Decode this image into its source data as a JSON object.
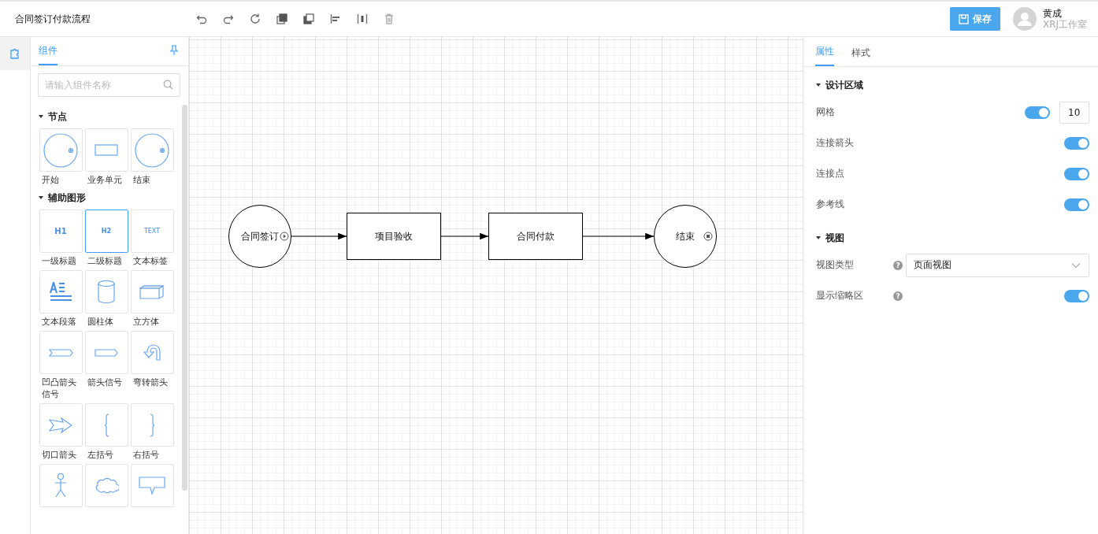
{
  "header": {
    "title": "合同签订付款流程",
    "toolbar": [
      {
        "kind": "undo"
      },
      {
        "kind": "redo"
      },
      {
        "kind": "refresh"
      },
      {
        "kind": "bring-front"
      },
      {
        "kind": "send-back"
      },
      {
        "kind": "align-left"
      },
      {
        "kind": "align-center"
      },
      {
        "kind": "delete"
      }
    ],
    "save_button": "保存",
    "user": {
      "name": "黄成",
      "org": "XRJ工作室"
    }
  },
  "left_panel": {
    "tabs": [
      {
        "label": "组件",
        "selected": true
      }
    ],
    "search": {
      "placeholder": "请输入组件名称"
    },
    "groups": [
      {
        "title": "节点",
        "expanded": true,
        "items": [
          {
            "kind": "start",
            "label": "开始",
            "selected": false
          },
          {
            "kind": "task",
            "label": "业务单元",
            "selected": false
          },
          {
            "kind": "end",
            "label": "结束",
            "selected": false
          }
        ]
      },
      {
        "title": "辅助图形",
        "expanded": true,
        "items": [
          {
            "kind": "h1",
            "glyph": "H1",
            "label": "一级标题",
            "selected": false
          },
          {
            "kind": "h2",
            "glyph": "H2",
            "label": "二级标题",
            "selected": true
          },
          {
            "kind": "text",
            "glyph": "TEXT",
            "label": "文本标签",
            "selected": false
          },
          {
            "kind": "paragraph",
            "label": "文本段落",
            "selected": false
          },
          {
            "kind": "cylinder",
            "label": "圆柱体",
            "selected": false
          },
          {
            "kind": "cube",
            "label": "立方体",
            "selected": false
          },
          {
            "kind": "notch-arrow",
            "label": "凹凸箭头信号",
            "selected": false
          },
          {
            "kind": "signal-arrow",
            "label": "箭头信号",
            "selected": false
          },
          {
            "kind": "u-turn",
            "label": "弯转箭头",
            "selected": false
          },
          {
            "kind": "cut-arrow",
            "label": "切口箭头",
            "selected": false
          },
          {
            "kind": "left-brace",
            "label": "左括号",
            "selected": false
          },
          {
            "kind": "right-brace",
            "label": "右括号",
            "selected": false
          },
          {
            "kind": "actor",
            "selected": false
          },
          {
            "kind": "cloud",
            "selected": false
          },
          {
            "kind": "callout",
            "selected": false
          }
        ]
      }
    ]
  },
  "canvas": {
    "nodes": [
      {
        "kind": "start",
        "label": "合同签订"
      },
      {
        "kind": "task",
        "label": "项目验收"
      },
      {
        "kind": "task",
        "label": "合同付款"
      },
      {
        "kind": "end",
        "label": "结束"
      }
    ]
  },
  "right_panel": {
    "tabs": [
      {
        "label": "属性",
        "selected": true
      },
      {
        "label": "样式",
        "selected": false
      }
    ],
    "sections": [
      {
        "title": "设计区域",
        "expanded": true,
        "rows": [
          {
            "kind": "switch",
            "label": "网格",
            "on": true,
            "value": "10"
          },
          {
            "kind": "switch",
            "label": "连接箭头",
            "on": true
          },
          {
            "kind": "switch",
            "label": "连接点",
            "on": true
          },
          {
            "kind": "switch",
            "label": "参考线",
            "on": true
          }
        ]
      },
      {
        "title": "视图",
        "expanded": true,
        "rows": [
          {
            "kind": "select",
            "label": "视图类型",
            "help": "?",
            "value": "页面视图"
          },
          {
            "kind": "switch",
            "label": "显示缩略区",
            "help": "?",
            "on": true
          }
        ]
      }
    ]
  }
}
